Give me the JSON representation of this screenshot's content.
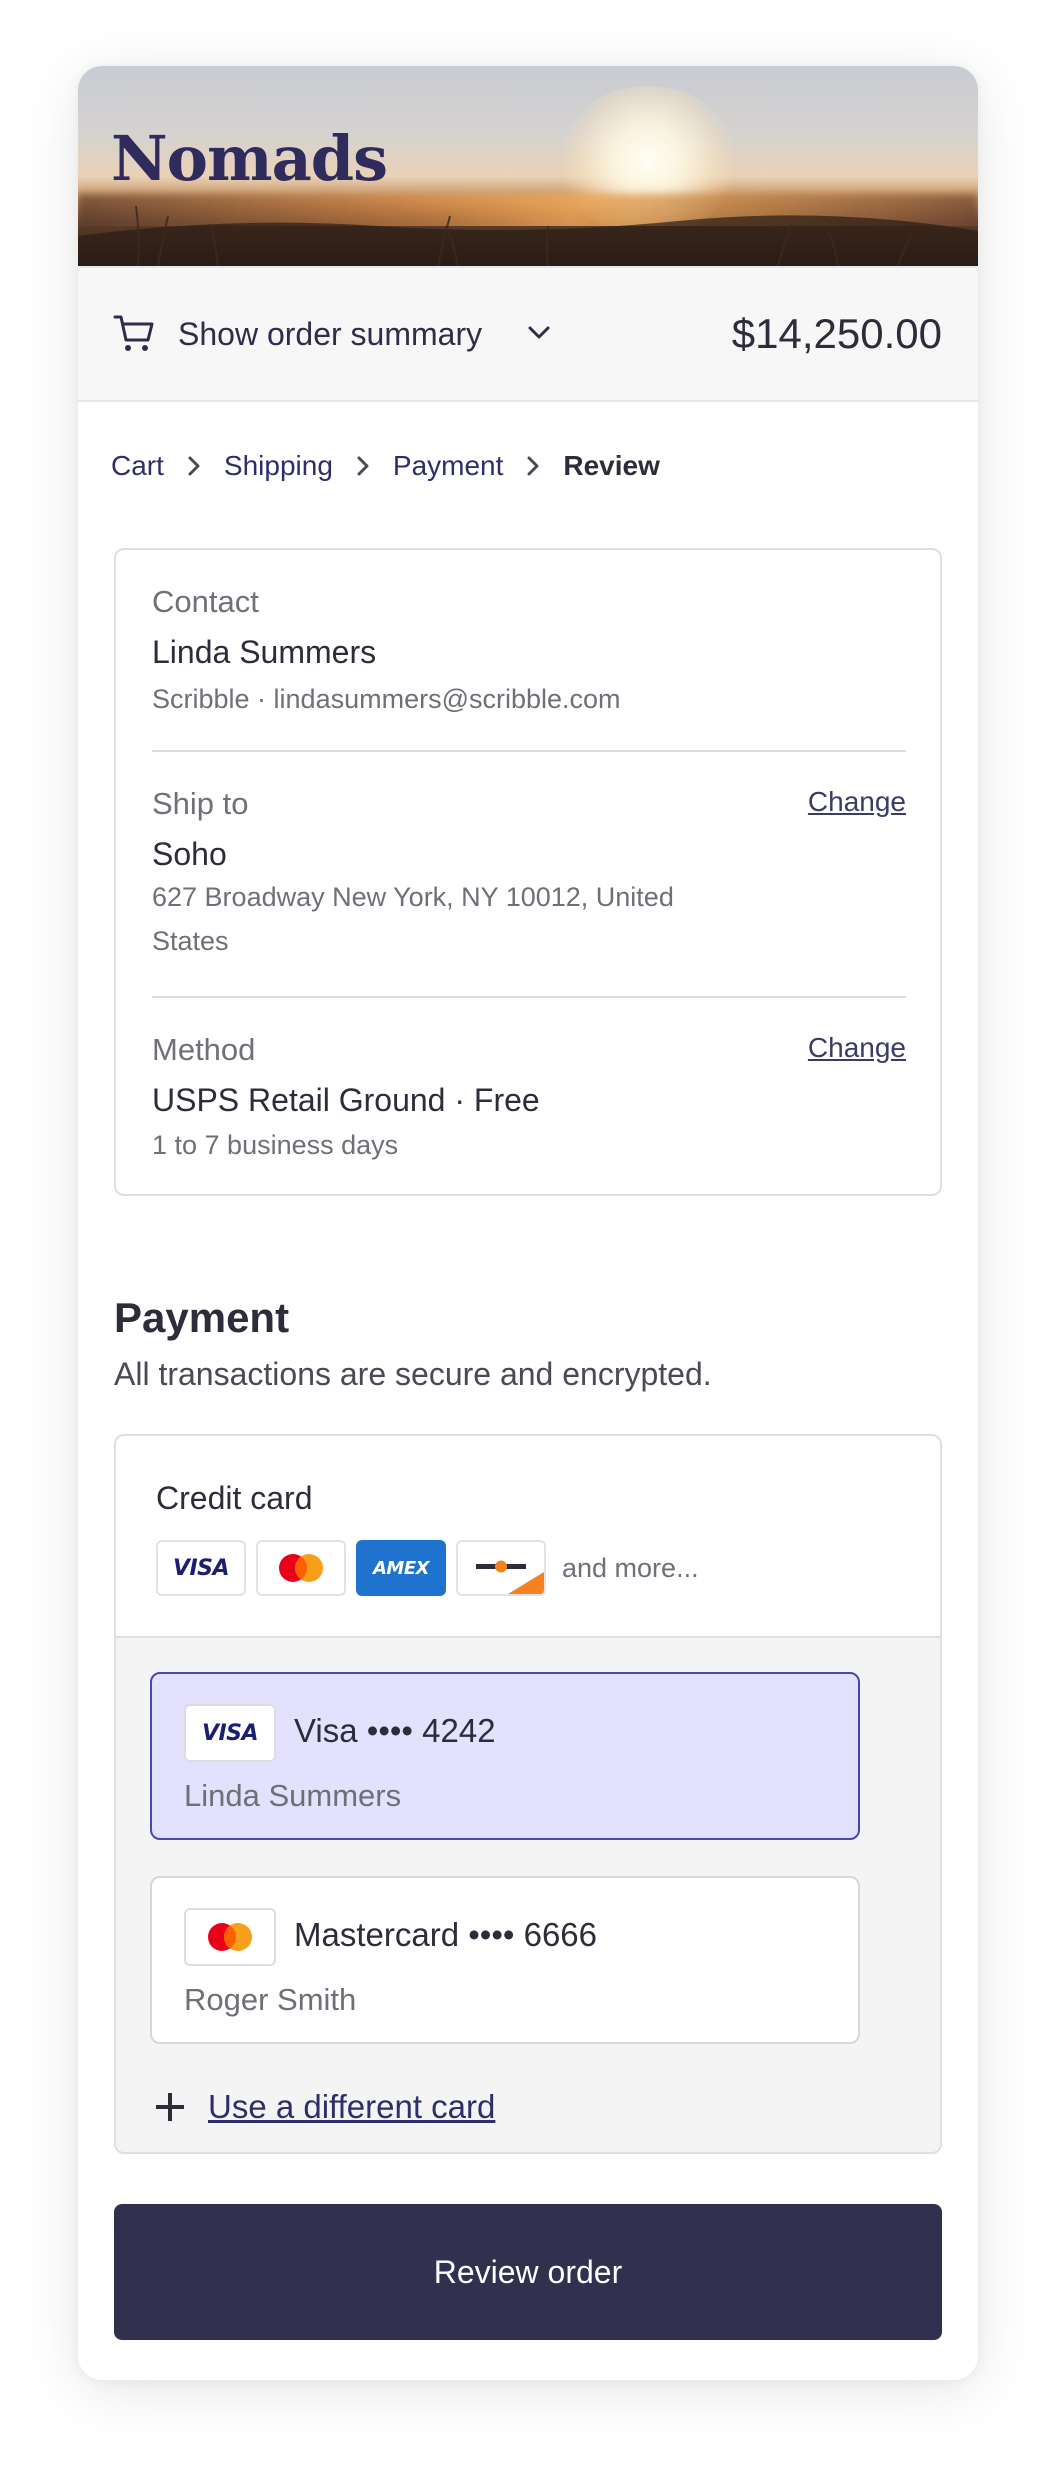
{
  "brand": {
    "name": "Nomads"
  },
  "summary": {
    "toggle_label": "Show order summary",
    "total": "$14,250.00",
    "icons": [
      "cart-icon",
      "chevron-down-icon"
    ]
  },
  "breadcrumb": {
    "items": [
      {
        "label": "Cart"
      },
      {
        "label": "Shipping"
      },
      {
        "label": "Payment"
      },
      {
        "label": "Review",
        "current": true
      }
    ],
    "separator_icon": "chevron-right-icon"
  },
  "review": {
    "contact": {
      "label": "Contact",
      "name": "Linda Summers",
      "detail": "Scribble · lindasummers@scribble.com"
    },
    "ship_to": {
      "label": "Ship to",
      "name": "Soho",
      "address": "627 Broadway New York, NY 10012, United States",
      "change_label": "Change"
    },
    "method": {
      "label": "Method",
      "name": "USPS Retail Ground · Free",
      "detail": "1 to 7 business days",
      "change_label": "Change"
    }
  },
  "payment": {
    "title": "Payment",
    "subtitle": "All transactions are secure and encrypted.",
    "credit_card": {
      "title": "Credit card",
      "brand_logos": [
        "VISA",
        "mastercard-logo",
        "AMEX",
        "discover-logo"
      ],
      "visa_logo_text": "VISA",
      "amex_logo_text": "AMEX",
      "more_label": "and more..."
    },
    "saved_cards": [
      {
        "brand": "visa",
        "logo_text": "VISA",
        "label": "Visa •••• 4242",
        "holder": "Linda Summers",
        "selected": true
      },
      {
        "brand": "mastercard",
        "label": "Mastercard •••• 6666",
        "holder": "Roger Smith",
        "selected": false
      }
    ],
    "add_card_label": "Use a different card"
  },
  "actions": {
    "review_order_label": "Review order"
  },
  "colors": {
    "brand_text": "#2f2b5c",
    "primary_button": "#32304f",
    "selected_card_bg": "#e3e1fd",
    "selected_card_border": "#4a48b0",
    "link": "#2f2e6a"
  }
}
